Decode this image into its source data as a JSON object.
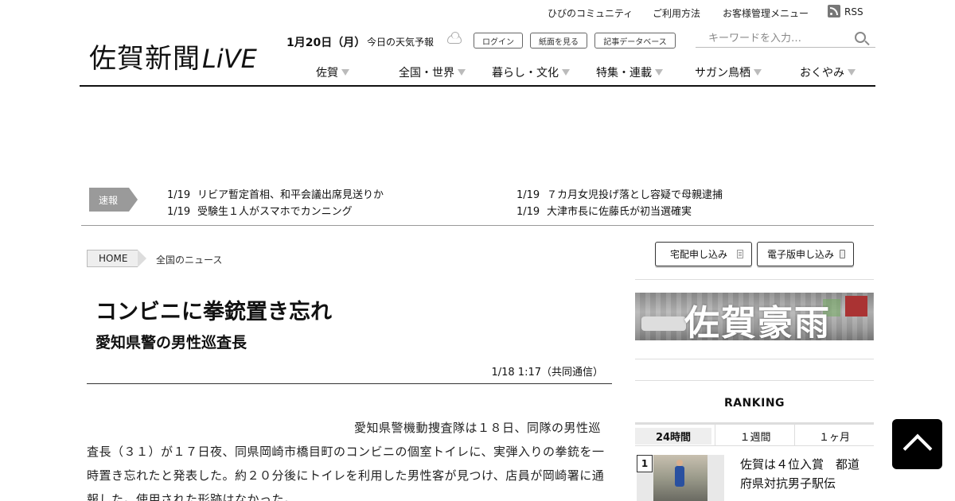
{
  "header": {
    "util_links": [
      "ひびのコミュニティ",
      "ご利用方法",
      "お客様管理メニュー"
    ],
    "rss_label": "RSS",
    "logo_text": "佐賀新聞",
    "logo_live": "LiVE",
    "date": "1月20日（月）",
    "weather_label": "今日の天気予報",
    "buttons": {
      "login": "ログイン",
      "paper": "紙面を見る",
      "database": "記事データベース"
    },
    "search_placeholder": "キーワードを入力…"
  },
  "nav": {
    "items": [
      "佐賀",
      "全国・世界",
      "暮らし・文化",
      "特集・連載",
      "サガン鳥栖",
      "おくやみ"
    ]
  },
  "breaking": {
    "label": "速報",
    "items": [
      {
        "date": "1/19",
        "text": "リビア暫定首相、和平会議出席見送りか"
      },
      {
        "date": "1/19",
        "text": "受験生１人がスマホでカンニング"
      },
      {
        "date": "1/19",
        "text": "７カ月女児投げ落とし容疑で母親逮捕"
      },
      {
        "date": "1/19",
        "text": "大津市長に佐藤氏が初当選確実"
      }
    ]
  },
  "breadcrumb": {
    "home": "HOME",
    "current": "全国のニュース"
  },
  "article": {
    "headline": "コンビニに拳銃置き忘れ",
    "subhead": "愛知県警の男性巡査長",
    "timestamp": "1/18 1:17（共同通信）",
    "body": "愛知県警機動捜査隊は１８日、同隊の男性巡査長（３１）が１７日夜、同県岡崎市橋目町のコンビニの個室トイレに、実弾入りの拳銃を一時置き忘れたと発表した。約２０分後にトイレを利用した男性客が見つけ、店員が岡崎署に通報した。使用された形跡はなかった。"
  },
  "sidebar": {
    "home_delivery": "宅配申し込み",
    "digital": "電子版申し込み",
    "banner_text": "佐賀豪雨",
    "ranking_title": "RANKING",
    "ranking_tabs": [
      "24時間",
      "１週間",
      "１ヶ月"
    ],
    "ranking_items": [
      {
        "rank": "1",
        "title": "佐賀は４位入賞　都道府県対抗男子駅伝"
      }
    ]
  },
  "colors": {
    "rule": "#111111",
    "breaking_tab": "#9a9a9a",
    "to_top": "#000000"
  },
  "icons": {
    "rss": "rss-icon",
    "weather": "cloud-icon",
    "search": "search-icon",
    "to_top": "chevron-up-icon"
  }
}
